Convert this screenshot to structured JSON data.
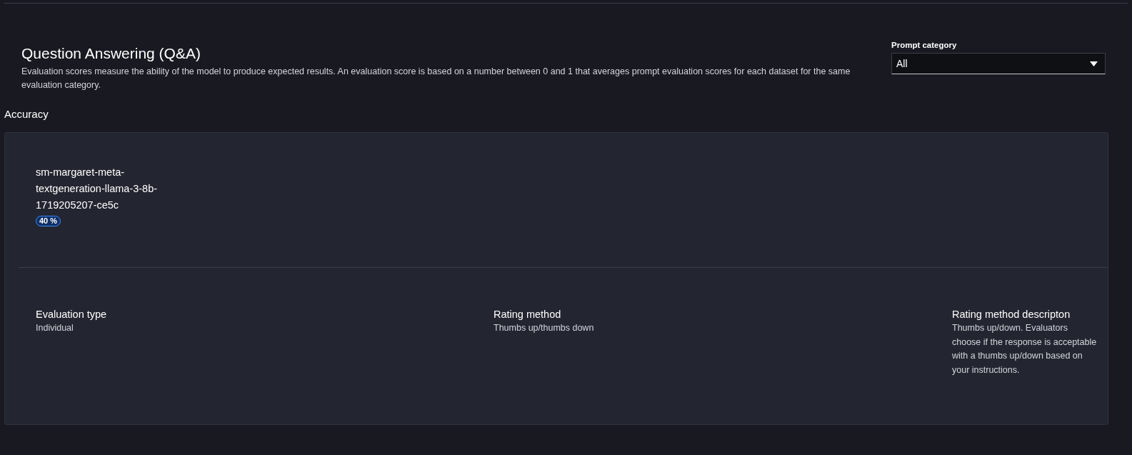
{
  "header": {
    "title": "Question Answering (Q&A)",
    "description": "Evaluation scores measure the ability of the model to produce expected results. An evaluation score is based on a number between 0 and 1 that averages prompt evaluation scores for each dataset for the same evaluation category."
  },
  "prompt_category": {
    "label": "Prompt category",
    "value": "All"
  },
  "section_title": "Accuracy",
  "model": {
    "name": "sm-margaret-meta-textgeneration-llama-3-8b-1719205207-ce5c",
    "score": "40 %"
  },
  "details": [
    {
      "label": "Evaluation type",
      "value": "Individual"
    },
    {
      "label": "Rating method",
      "value": "Thumbs up/thumbs down"
    },
    {
      "label": "Rating method descripton",
      "value": "Thumbs up/down. Evaluators choose if the response is acceptable with a thumbs up/down based on your instructions."
    }
  ]
}
